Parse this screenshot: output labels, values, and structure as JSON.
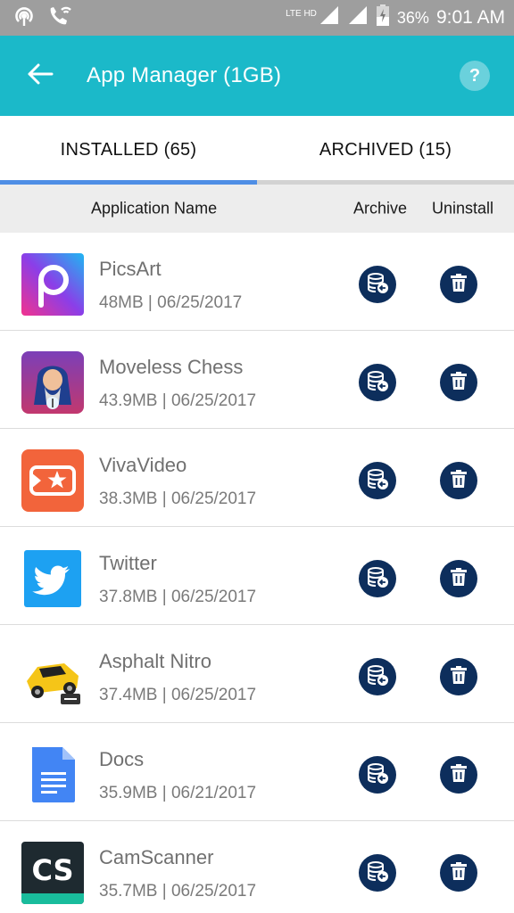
{
  "status_bar": {
    "network_label": "LTE HD",
    "battery": "36%",
    "time": "9:01 AM"
  },
  "app_bar": {
    "title": "App Manager (1GB)",
    "help_label": "?",
    "color": "#1bb9c9"
  },
  "tabs": [
    {
      "label": "INSTALLED (65)",
      "active": true
    },
    {
      "label": "ARCHIVED (15)",
      "active": false
    }
  ],
  "columns": {
    "name": "Application Name",
    "archive": "Archive",
    "uninstall": "Uninstall"
  },
  "apps": [
    {
      "name": "PicsArt",
      "meta": "48MB | 06/25/2017",
      "icon": "picsart-icon"
    },
    {
      "name": "Moveless Chess",
      "meta": "43.9MB | 06/25/2017",
      "icon": "moveless-chess-icon"
    },
    {
      "name": "VivaVideo",
      "meta": "38.3MB | 06/25/2017",
      "icon": "vivavideo-icon"
    },
    {
      "name": "Twitter",
      "meta": "37.8MB | 06/25/2017",
      "icon": "twitter-icon"
    },
    {
      "name": "Asphalt Nitro",
      "meta": "37.4MB | 06/25/2017",
      "icon": "asphalt-nitro-icon"
    },
    {
      "name": "Docs",
      "meta": "35.9MB | 06/21/2017",
      "icon": "docs-icon"
    },
    {
      "name": "CamScanner",
      "meta": "35.7MB | 06/25/2017",
      "icon": "camscanner-icon",
      "icon_text": "CS"
    }
  ],
  "colors": {
    "accent_tab": "#4f8ee5",
    "action_button": "#0d2e5c"
  }
}
